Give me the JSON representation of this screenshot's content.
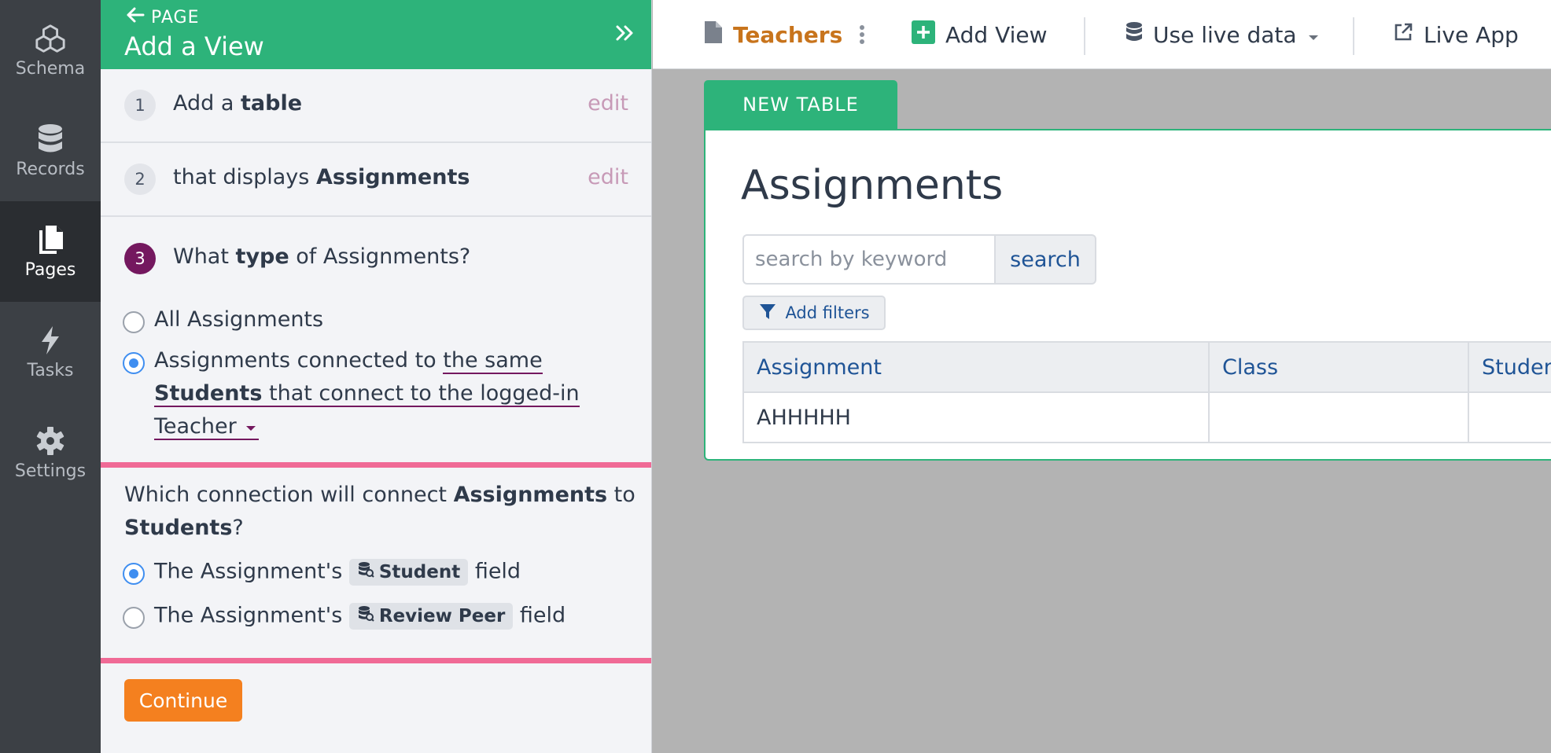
{
  "nav": {
    "items": [
      {
        "label": "Schema",
        "icon": "cubes-icon"
      },
      {
        "label": "Records",
        "icon": "database-icon"
      },
      {
        "label": "Pages",
        "icon": "pages-icon",
        "active": true
      },
      {
        "label": "Tasks",
        "icon": "bolt-icon"
      },
      {
        "label": "Settings",
        "icon": "gear-icon"
      }
    ]
  },
  "panel": {
    "back_label": "PAGE",
    "title": "Add a View",
    "steps": [
      {
        "num": "1",
        "prefix": "Add a ",
        "bold": "table",
        "edit": "edit"
      },
      {
        "num": "2",
        "prefix": "that displays ",
        "bold": "Assignments",
        "edit": "edit"
      },
      {
        "num": "3",
        "prefix": "What ",
        "bold": "type",
        "suffix": " of Assignments?"
      }
    ],
    "type_options": {
      "all": "All Assignments",
      "connected_prefix": "Assignments connected to ",
      "connected_sel_1": "the same",
      "connected_sel_2_bold": "Students",
      "connected_sel_2_rest": " that connect to the logged-in",
      "connected_sel_3": "Teacher"
    },
    "connection": {
      "q_prefix": "Which connection will connect ",
      "q_bold_1": "Assignments",
      "q_mid": " to",
      "q_bold_2": "Students",
      "q_end": "?",
      "options": [
        {
          "prefix": "The Assignment's ",
          "field": "Student",
          "suffix": " field",
          "selected": true
        },
        {
          "prefix": "The Assignment's ",
          "field": "Review Peer",
          "suffix": " field",
          "selected": false
        }
      ]
    },
    "continue_label": "Continue"
  },
  "topbar": {
    "page_name": "Teachers",
    "add_view": "Add View",
    "live_data": "Use live data",
    "live_app": "Live App"
  },
  "view": {
    "tab_label": "NEW TABLE",
    "title": "Assignments",
    "search_placeholder": "search by keyword",
    "search_button": "search",
    "filters_button": "Add filters",
    "columns": [
      "Assignment",
      "Class",
      "Students"
    ],
    "rows": [
      [
        "AHHHHH",
        "",
        ""
      ]
    ]
  },
  "colors": {
    "accent_green": "#2db37a",
    "step_current": "#74185f",
    "highlight_box": "#f06a96",
    "continue_orange": "#f4801f",
    "page_name_orange": "#c8741c",
    "link_blue": "#1f5496"
  }
}
